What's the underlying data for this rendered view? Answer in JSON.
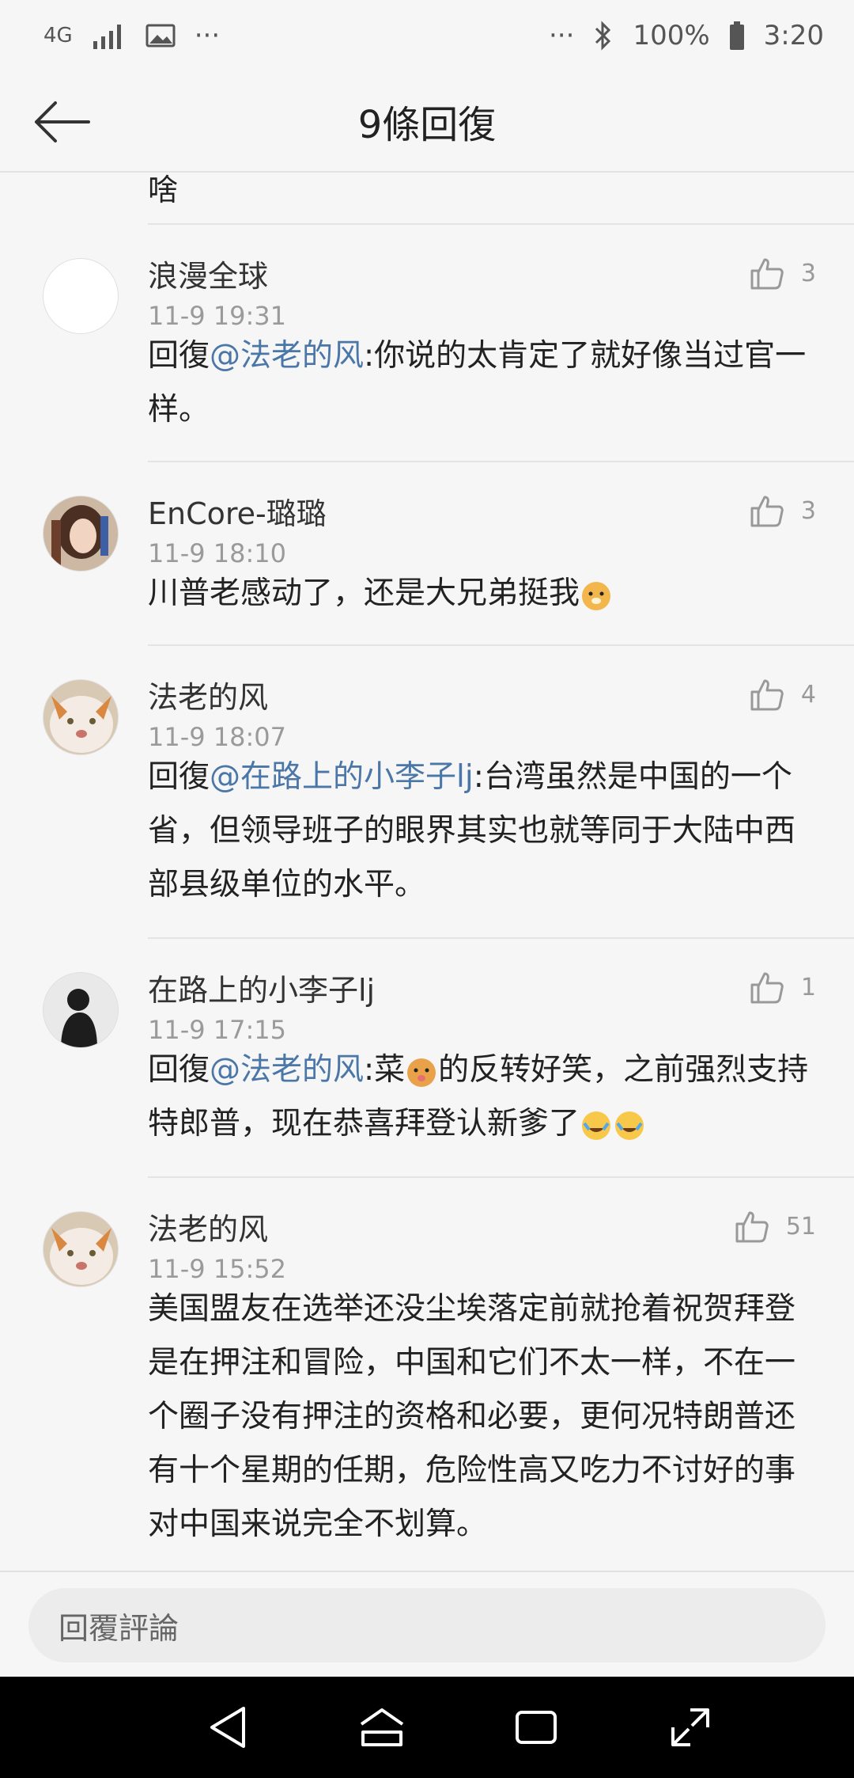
{
  "status_bar": {
    "network": "4G",
    "more": "···",
    "right_more": "···",
    "battery": "100%",
    "time": "3:20"
  },
  "header": {
    "title": "9條回復"
  },
  "partial_comment": {
    "text": "啥"
  },
  "comments": [
    {
      "username": "浪漫全球",
      "time": "11-9 19:31",
      "likes": "3",
      "reply_prefix": "回復",
      "mention": "@法老的风",
      "text": ":你说的太肯定了就好像当过官一样。"
    },
    {
      "username": "EnCore-璐璐",
      "time": "11-9 18:10",
      "likes": "3",
      "text": "川普老感动了，还是大兄弟挺我"
    },
    {
      "username": "法老的风",
      "time": "11-9 18:07",
      "likes": "4",
      "reply_prefix": "回復",
      "mention": "@在路上的小李子lj",
      "text": ":台湾虽然是中国的一个省，但领导班子的眼界其实也就等同于大陆中西部县级单位的水平。"
    },
    {
      "username": "在路上的小李子lj",
      "time": "11-9 17:15",
      "likes": "1",
      "reply_prefix": "回復",
      "mention": "@法老的风",
      "text_a": ":菜",
      "text_b": "的反转好笑，之前强烈支持特郎普，现在恭喜拜登认新爹了"
    },
    {
      "username": "法老的风",
      "time": "11-9 15:52",
      "likes": "51",
      "text": "美国盟友在选举还没尘埃落定前就抢着祝贺拜登是在押注和冒险，中国和它们不太一样，不在一个圈子没有押注的资格和必要，更何况特朗普还有十个星期的任期，危险性高又吃力不讨好的事对中国来说完全不划算。"
    }
  ],
  "reply_box": {
    "placeholder": "回覆評論"
  }
}
